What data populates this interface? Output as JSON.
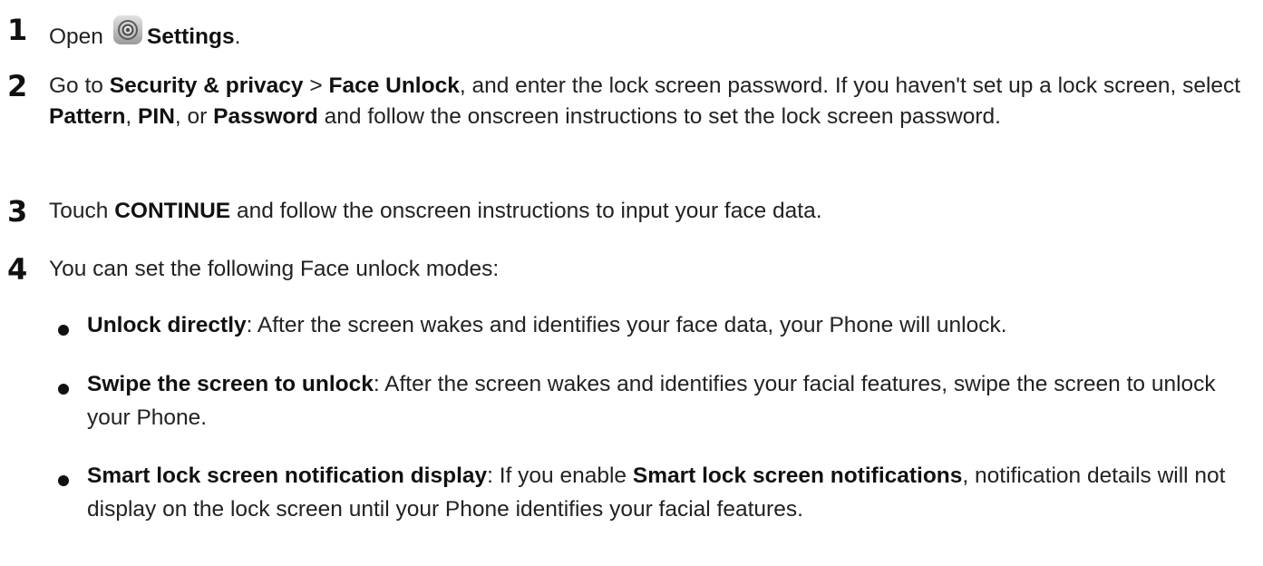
{
  "steps": [
    {
      "number": "1",
      "open_label": "Open",
      "settings_label": "Settings",
      "trailing": "."
    },
    {
      "number": "2",
      "go_to": "Go to",
      "security_privacy": "Security & privacy",
      "separator": " > ",
      "face_unlock": "Face Unlock",
      "text_after_face_unlock": ", and enter the lock screen password. If you haven't set up a lock screen, select",
      "pattern": "Pattern",
      "comma1": ",",
      "pin": "PIN",
      "or_text": ", or",
      "password": "Password",
      "text_end": "and follow the onscreen instructions to set the lock screen password."
    },
    {
      "number": "3",
      "touch": "Touch",
      "continue_label": "CONTINUE",
      "text_end": "and follow the onscreen instructions to input your face data."
    },
    {
      "number": "4",
      "intro": "You can set the following Face unlock modes:"
    }
  ],
  "modes": [
    {
      "title": "Unlock directly",
      "description": ": After the screen wakes and identifies your face data, your Phone will unlock."
    },
    {
      "title": "Swipe the screen to unlock",
      "description": ": After the screen wakes and identifies your facial features, swipe the screen to unlock your Phone."
    },
    {
      "title": "Smart lock screen notification display",
      "description_start": ": If you enable",
      "highlight": "Smart lock screen notifications",
      "description_end": ", notification details will not display on the lock screen until your Phone identifies your facial features."
    }
  ],
  "icons": {
    "settings": "settings-gear-icon"
  }
}
